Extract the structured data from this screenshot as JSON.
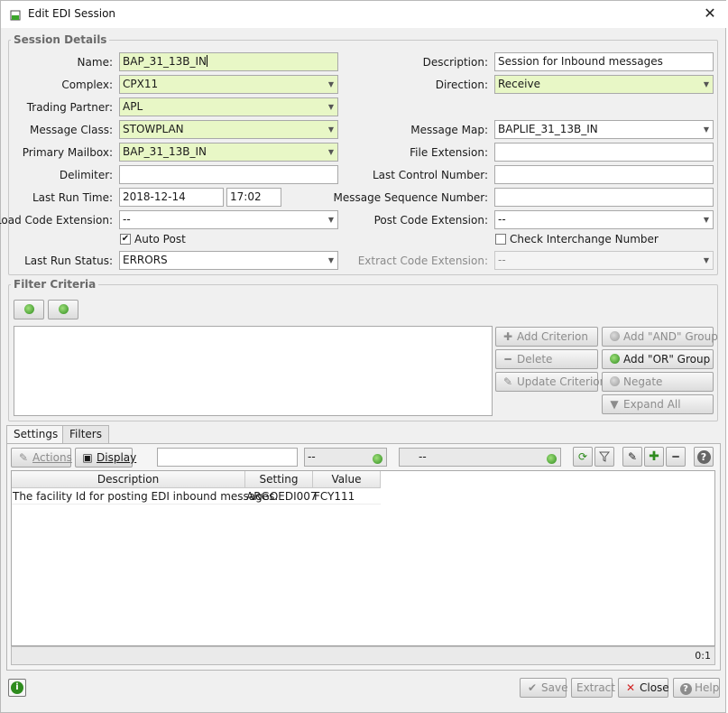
{
  "window": {
    "title": "Edit EDI Session",
    "close_symbol": "✕"
  },
  "session_details": {
    "legend": "Session Details",
    "name": {
      "label": "Name:",
      "value": "BAP_31_13B_IN"
    },
    "complex": {
      "label": "Complex:",
      "value": "CPX11"
    },
    "trading_partner": {
      "label": "Trading Partner:",
      "value": "APL"
    },
    "message_class": {
      "label": "Message Class:",
      "value": "STOWPLAN"
    },
    "primary_mailbox": {
      "label": "Primary Mailbox:",
      "value": "BAP_31_13B_IN"
    },
    "delimiter": {
      "label": "Delimiter:",
      "value": ""
    },
    "last_run_time": {
      "label": "Last Run Time:",
      "date": "2018-12-14",
      "time": "17:02"
    },
    "load_code_extension": {
      "label": "Load Code Extension:",
      "value": "--"
    },
    "auto_post": {
      "label": "Auto Post",
      "checked": true,
      "mark": "✔"
    },
    "last_run_status": {
      "label": "Last Run Status:",
      "value": "ERRORS"
    },
    "description": {
      "label": "Description:",
      "value": "Session for Inbound messages"
    },
    "direction": {
      "label": "Direction:",
      "value": "Receive"
    },
    "message_map": {
      "label": "Message Map:",
      "value": "BAPLIE_31_13B_IN"
    },
    "file_extension": {
      "label": "File Extension:",
      "value": ""
    },
    "last_control_number": {
      "label": "Last Control Number:",
      "value": ""
    },
    "message_sequence_number": {
      "label": "Message Sequence Number:",
      "value": ""
    },
    "post_code_extension": {
      "label": "Post Code Extension:",
      "value": "--"
    },
    "check_interchange_number": {
      "label": "Check Interchange Number",
      "checked": false
    },
    "extract_code_extension": {
      "label": "Extract Code Extension:",
      "value": "--"
    }
  },
  "filter_criteria": {
    "legend": "Filter Criteria",
    "buttons": {
      "add_criterion": "Add Criterion",
      "add_and_group": "Add \"AND\" Group",
      "delete": "Delete",
      "add_or_group": "Add \"OR\" Group",
      "update_criterion": "Update Criterion",
      "negate": "Negate",
      "expand_all": "Expand All"
    }
  },
  "tabs": [
    "Settings",
    "Filters"
  ],
  "toolbar": {
    "actions": "Actions",
    "display": "Display",
    "search_value": "",
    "filter1": "--",
    "filter2": "--"
  },
  "settings_table": {
    "columns": [
      "Description",
      "Setting",
      "Value"
    ],
    "rows": [
      {
        "description": "The facility Id for posting EDI inbound messages.",
        "setting": "ARGOEDI007",
        "value": "FCY111"
      }
    ],
    "count": "0:1"
  },
  "footer": {
    "save": "Save",
    "extract": "Extract",
    "close": "Close",
    "help": "Help"
  },
  "colors": {
    "required_field": "#e8f7c6",
    "accent_green": "#2e8b1e",
    "close_red": "#d22222"
  }
}
